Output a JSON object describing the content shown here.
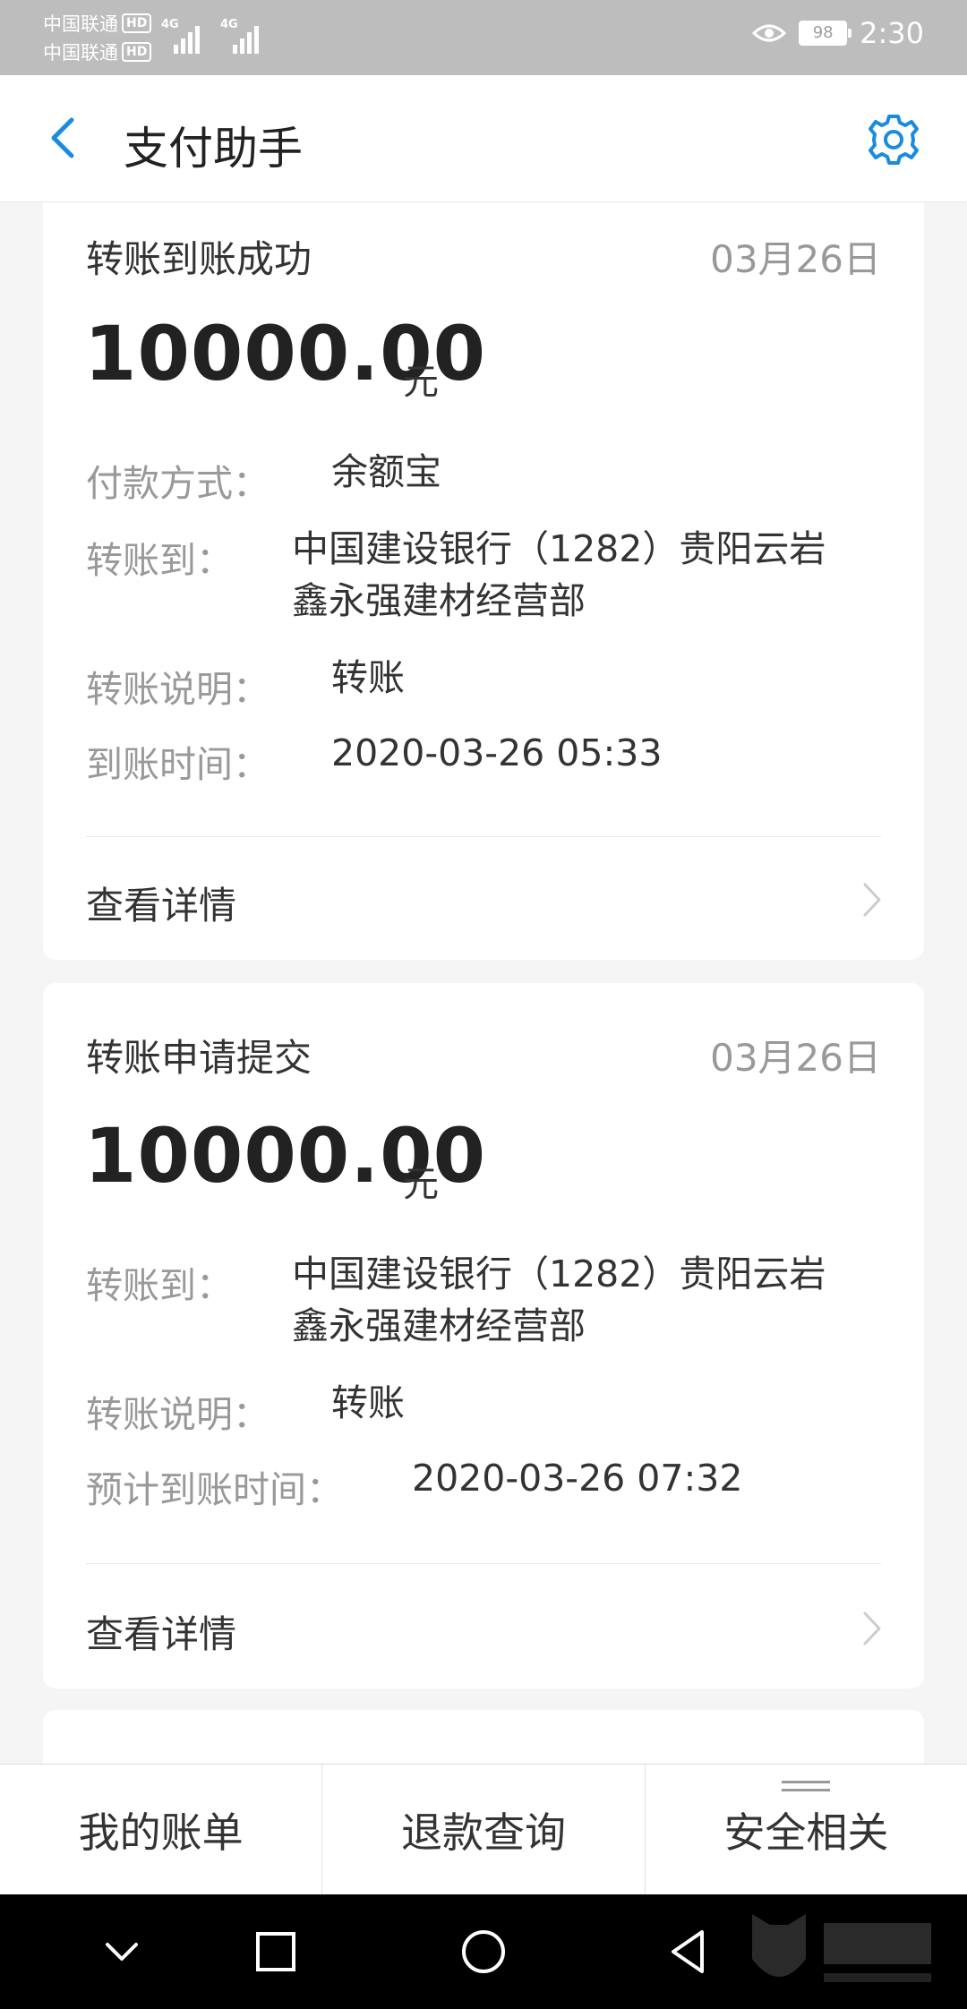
{
  "status_bar": {
    "carrier_1": "中国联通",
    "carrier_2": "中国联通",
    "hd_badge": "HD",
    "network_1": "4G",
    "network_2": "4G",
    "battery": "98",
    "time": "2:30"
  },
  "header": {
    "title": "支付助手",
    "back_icon": "chevron-left-icon",
    "settings_icon": "gear-icon"
  },
  "cards": [
    {
      "title": "转账到账成功",
      "date": "03月26日",
      "amount": "10000.00",
      "unit": "元",
      "rows": [
        {
          "label": "付款方式：",
          "value": "余额宝"
        },
        {
          "label": "转账到：",
          "value_line1": "中国建设银行（1282）贵阳云岩",
          "value_line2": "鑫永强建材经营部"
        },
        {
          "label": "转账说明：",
          "value": "转账"
        },
        {
          "label": "到账时间：",
          "value": "2020-03-26 05:33"
        }
      ],
      "details_label": "查看详情"
    },
    {
      "title": "转账申请提交",
      "date": "03月26日",
      "amount": "10000.00",
      "unit": "元",
      "rows": [
        {
          "label": "转账到：",
          "value_line1": "中国建设银行（1282）贵阳云岩",
          "value_line2": "鑫永强建材经营部"
        },
        {
          "label": "转账说明：",
          "value": "转账"
        },
        {
          "label": "预计到账时间：",
          "value": "2020-03-26 07:32"
        }
      ],
      "details_label": "查看详情"
    }
  ],
  "tabs": [
    {
      "label": "我的账单"
    },
    {
      "label": "退款查询"
    },
    {
      "label": "安全相关"
    }
  ],
  "colors": {
    "accent": "#1a8be0",
    "status_bar": "#bdbdbd",
    "label_gray": "#999999",
    "text": "#333333",
    "background": "#f5f5f5"
  }
}
